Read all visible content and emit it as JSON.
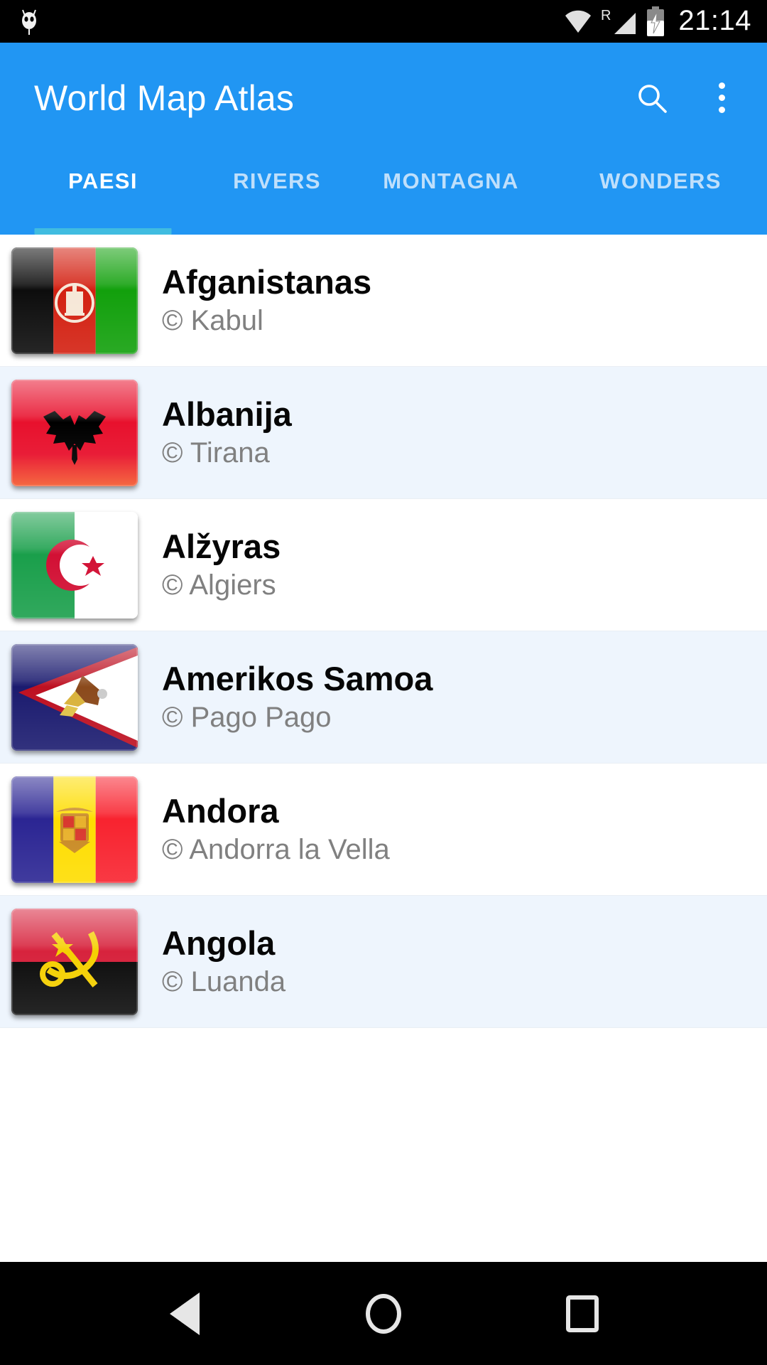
{
  "status_bar": {
    "notification_icon": "owl-icon",
    "wifi_icon": "wifi-icon",
    "roaming_label": "R",
    "signal_icon": "signal-icon",
    "battery_icon": "battery-charging-icon",
    "time": "21:14"
  },
  "app_bar": {
    "title": "World Map Atlas",
    "search_icon": "search-icon",
    "overflow_icon": "overflow-menu-icon",
    "background_color": "#2196f3"
  },
  "tabs": {
    "active_index": 0,
    "indicator_color": "#40bce0",
    "items": [
      {
        "label": "PAESI"
      },
      {
        "label": "RIVERS"
      },
      {
        "label": "MONTAGNA"
      },
      {
        "label": "WONDERS"
      }
    ]
  },
  "list": {
    "alt_row_color": "#eef5fd",
    "items": [
      {
        "name": "Afganistanas",
        "capital": "© Kabul",
        "flag": "afghanistan"
      },
      {
        "name": "Albanija",
        "capital": "© Tirana",
        "flag": "albania"
      },
      {
        "name": "Alžyras",
        "capital": "© Algiers",
        "flag": "algeria"
      },
      {
        "name": "Amerikos Samoa",
        "capital": "© Pago Pago",
        "flag": "american-samoa"
      },
      {
        "name": "Andora",
        "capital": "© Andorra la Vella",
        "flag": "andorra"
      },
      {
        "name": "Angola",
        "capital": "© Luanda",
        "flag": "angola"
      }
    ]
  },
  "nav_bar": {
    "back_label": "back-icon",
    "home_label": "home-icon",
    "recents_label": "recents-icon"
  }
}
